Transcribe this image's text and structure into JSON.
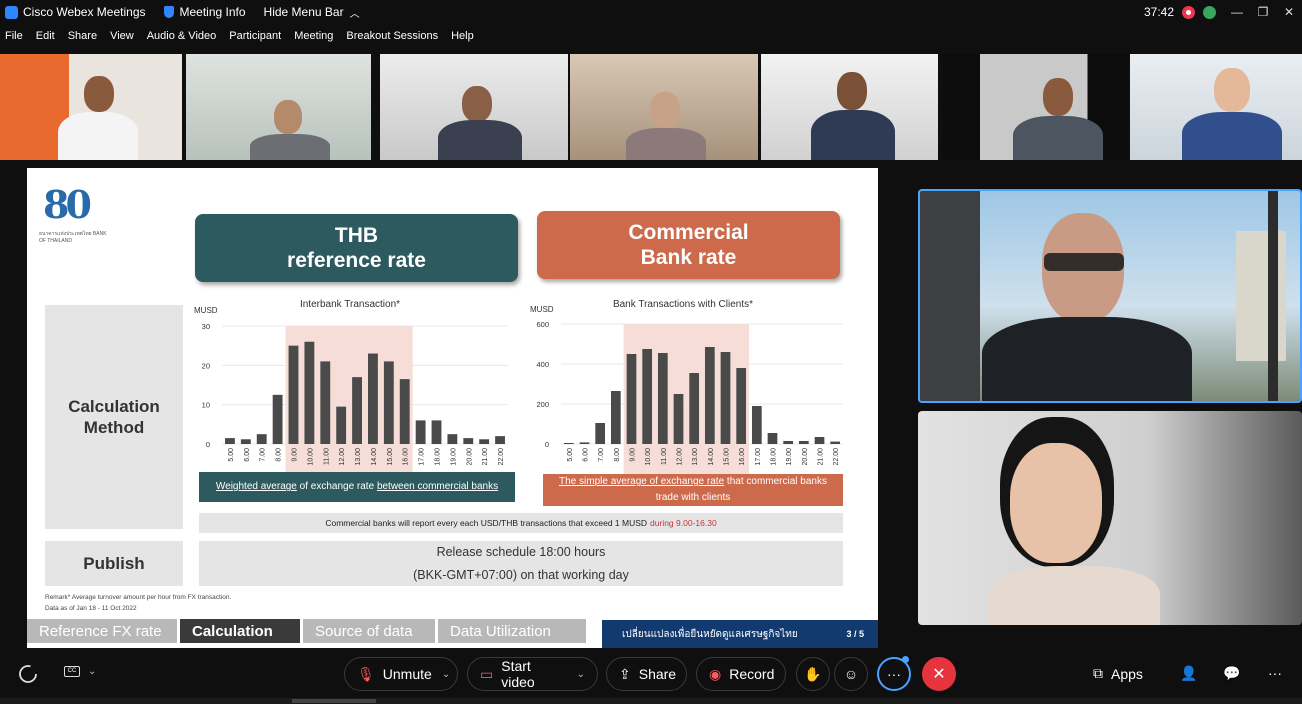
{
  "titlebar": {
    "app_name": "Cisco Webex Meetings",
    "meeting_info": "Meeting Info",
    "hide_menu": "Hide Menu Bar",
    "timer": "37:42"
  },
  "menu": [
    "File",
    "Edit",
    "Share",
    "View",
    "Audio & Video",
    "Participant",
    "Meeting",
    "Breakout Sessions",
    "Help"
  ],
  "slide": {
    "logo_text": "ธนาคารแห่งประเทศไทย BANK OF THAILAND",
    "logo_numeral": "80",
    "thb_header_line1": "THB",
    "thb_header_line2": "reference rate",
    "cb_header_line1": "Commercial",
    "cb_header_line2": "Bank rate",
    "calc_label_line1": "Calculation",
    "calc_label_line2": "Method",
    "publish_label": "Publish",
    "thb_desc_a": "Weighted average",
    "thb_desc_b": " of exchange rate ",
    "thb_desc_c": "between commercial banks",
    "cb_desc_a": "The simple average of exchange rate",
    "cb_desc_b": " that commercial banks trade with clients",
    "note_text": "Commercial banks will report every each USD/THB transactions that exceed 1 MUSD",
    "note_red": "during 9.00-16.30",
    "release_line1": "Release schedule 18:00 hours",
    "release_line2": "(BKK-GMT+07:00) on that working day",
    "remark_line1": "Remark*  Average turnover amount per hour from FX transaction.",
    "remark_line2": "Data as of  Jan 18 - 11 Oct 2022",
    "steps": [
      "Reference FX rate",
      "Calculation",
      "Source of data",
      "Data Utilization"
    ],
    "footer_text": "เปลี่ยนแปลงเพื่อยืนหยัดดูแลเศรษฐกิจไทย",
    "page": "3 / 5"
  },
  "chart_data": [
    {
      "type": "bar",
      "title": "Interbank Transaction*",
      "ylabel": "MUSD",
      "ylim": [
        0,
        30
      ],
      "yticks": [
        0,
        10,
        20,
        30
      ],
      "categories": [
        "5.00",
        "6.00",
        "7.00",
        "8.00",
        "9.00",
        "10.00",
        "11.00",
        "12.00",
        "13.00",
        "14.00",
        "15.00",
        "16.00",
        "17.00",
        "18.00",
        "19.00",
        "20.00",
        "21.00",
        "22.00"
      ],
      "values": [
        1.5,
        1.2,
        2.5,
        12.5,
        25,
        26,
        21,
        9.5,
        17,
        23,
        21,
        16.5,
        6,
        6,
        2.5,
        1.5,
        1.2,
        2
      ],
      "highlight_range": [
        "9.00",
        "16.00"
      ],
      "bar_color": "#4a4a4a",
      "highlight_color": "#f6ddd7"
    },
    {
      "type": "bar",
      "title": "Bank Transactions with Clients*",
      "ylabel": "MUSD",
      "ylim": [
        0,
        600
      ],
      "yticks": [
        0,
        200,
        400,
        600
      ],
      "categories": [
        "5.00",
        "6.00",
        "7.00",
        "8.00",
        "9.00",
        "10.00",
        "11.00",
        "12.00",
        "13.00",
        "14.00",
        "15.00",
        "16.00",
        "17.00",
        "18.00",
        "19.00",
        "20.00",
        "21.00",
        "22.00"
      ],
      "values": [
        5,
        8,
        105,
        265,
        450,
        475,
        455,
        250,
        355,
        485,
        460,
        380,
        190,
        55,
        15,
        15,
        35,
        12
      ],
      "highlight_range": [
        "9.00",
        "16.00"
      ],
      "bar_color": "#4a4a4a",
      "highlight_color": "#f6ddd7"
    }
  ],
  "toolbar": {
    "unmute": "Unmute",
    "start_video": "Start video",
    "share": "Share",
    "record": "Record",
    "more": "···",
    "apps": "Apps",
    "overflow": "···"
  }
}
